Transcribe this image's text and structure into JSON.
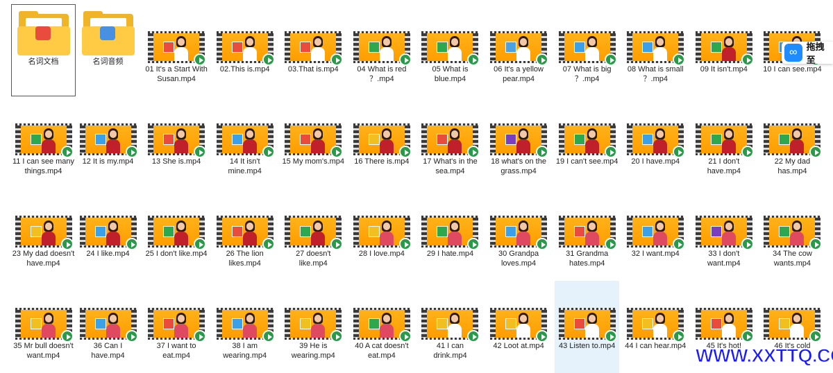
{
  "folders": [
    {
      "name": "名词文档",
      "badge_color": "#e74c3c",
      "selected": true
    },
    {
      "name": "名词音频",
      "badge_color": "#4a90e2",
      "selected": false
    }
  ],
  "videos": [
    {
      "name": "01 It's a Start With Susan.mp4",
      "card_color": "#e74c3c",
      "shirt_color": "#ffffff"
    },
    {
      "name": "02.This is.mp4",
      "card_color": "#e74c3c",
      "shirt_color": "#ffffff"
    },
    {
      "name": "03.That is.mp4",
      "card_color": "#e74c3c",
      "shirt_color": "#ffffff"
    },
    {
      "name": "04 What is red ？.mp4",
      "card_color": "#2ea84f",
      "shirt_color": "#ffffff"
    },
    {
      "name": "05 What is blue.mp4",
      "card_color": "#2ea84f",
      "shirt_color": "#ffffff"
    },
    {
      "name": "06 It's a yellow pear.mp4",
      "card_color": "#4aa3e0",
      "shirt_color": "#ffffff"
    },
    {
      "name": "07 What is big ？.mp4",
      "card_color": "#3aa0e8",
      "shirt_color": "#ffffff"
    },
    {
      "name": "08 What is small ？.mp4",
      "card_color": "#3aa0e8",
      "shirt_color": "#ffffff"
    },
    {
      "name": "09 It isn't.mp4",
      "card_color": "#2ea84f",
      "shirt_color": "#c0202a"
    },
    {
      "name": "10 I can see.mp4",
      "card_color": "#3aa0e8",
      "shirt_color": "#ffffff"
    },
    {
      "name": "11 I can see many things.mp4",
      "card_color": "#2ea84f",
      "shirt_color": "#c0202a"
    },
    {
      "name": "12 It is my.mp4",
      "card_color": "#3aa0e8",
      "shirt_color": "#c0202a"
    },
    {
      "name": "13 She is.mp4",
      "card_color": "#e74c3c",
      "shirt_color": "#c0202a"
    },
    {
      "name": "14 It isn't mine.mp4",
      "card_color": "#3aa0e8",
      "shirt_color": "#c0202a"
    },
    {
      "name": "15 My mom's.mp4",
      "card_color": "#e74c3c",
      "shirt_color": "#c0202a"
    },
    {
      "name": "16 There is.mp4",
      "card_color": "#f0c020",
      "shirt_color": "#c0202a"
    },
    {
      "name": "17 What's in the sea.mp4",
      "card_color": "#e74c3c",
      "shirt_color": "#c0202a"
    },
    {
      "name": "18 what's on the grass.mp4",
      "card_color": "#7a3fc0",
      "shirt_color": "#c0202a"
    },
    {
      "name": "19 I can't see.mp4",
      "card_color": "#2ea84f",
      "shirt_color": "#c0202a"
    },
    {
      "name": "20 I have.mp4",
      "card_color": "#3aa0e8",
      "shirt_color": "#c0202a"
    },
    {
      "name": "21 I don't have.mp4",
      "card_color": "#2ea84f",
      "shirt_color": "#c0202a"
    },
    {
      "name": "22 My dad has.mp4",
      "card_color": "#2ea84f",
      "shirt_color": "#c0202a"
    },
    {
      "name": "23 My dad doesn't have.mp4",
      "card_color": "#f0c020",
      "shirt_color": "#c0202a"
    },
    {
      "name": "24 I like.mp4",
      "card_color": "#3aa0e8",
      "shirt_color": "#c0202a"
    },
    {
      "name": "25 I don't like.mp4",
      "card_color": "#2ea84f",
      "shirt_color": "#c0202a"
    },
    {
      "name": "26 The lion likes.mp4",
      "card_color": "#e74c3c",
      "shirt_color": "#c0202a"
    },
    {
      "name": "27 doesn't like.mp4",
      "card_color": "#2ea84f",
      "shirt_color": "#c0202a"
    },
    {
      "name": "28 I love.mp4",
      "card_color": "#f0c020",
      "shirt_color": "#e04a60"
    },
    {
      "name": "29 I hate.mp4",
      "card_color": "#2ea84f",
      "shirt_color": "#e04a60"
    },
    {
      "name": "30 Grandpa loves.mp4",
      "card_color": "#3aa0e8",
      "shirt_color": "#e04a60"
    },
    {
      "name": "31 Grandma hates.mp4",
      "card_color": "#e74c3c",
      "shirt_color": "#e04a60"
    },
    {
      "name": "32 I want.mp4",
      "card_color": "#3aa0e8",
      "shirt_color": "#e04a60"
    },
    {
      "name": "33 I don't want.mp4",
      "card_color": "#7a3fc0",
      "shirt_color": "#e04a60"
    },
    {
      "name": "34 The cow wants.mp4",
      "card_color": "#2ea84f",
      "shirt_color": "#e04a60"
    },
    {
      "name": "35 Mr bull doesn't want.mp4",
      "card_color": "#f0c020",
      "shirt_color": "#e04a60"
    },
    {
      "name": "36 Can I have.mp4",
      "card_color": "#3aa0e8",
      "shirt_color": "#e04a60"
    },
    {
      "name": "37 I want to eat.mp4",
      "card_color": "#e74c3c",
      "shirt_color": "#e04a60"
    },
    {
      "name": "38 I am wearing.mp4",
      "card_color": "#3aa0e8",
      "shirt_color": "#e04a60"
    },
    {
      "name": "39 He is wearing.mp4",
      "card_color": "#f0c020",
      "shirt_color": "#e04a60"
    },
    {
      "name": "40 A cat doesn't eat.mp4",
      "card_color": "#2ea84f",
      "shirt_color": "#e04a60"
    },
    {
      "name": "41 I can drink.mp4",
      "card_color": "#f0c020",
      "shirt_color": "#ffffff"
    },
    {
      "name": "42 Loot at.mp4",
      "card_color": "#f0c020",
      "shirt_color": "#ffffff"
    },
    {
      "name": "43 Listen to.mp4",
      "card_color": "#e74c3c",
      "shirt_color": "#ffffff",
      "highlight": true
    },
    {
      "name": "44 I can hear.mp4",
      "card_color": "#f0c020",
      "shirt_color": "#ffffff"
    },
    {
      "name": "45 It's hot!",
      "card_color": "#e74c3c",
      "shirt_color": "#ffffff"
    },
    {
      "name": "46 It's cold",
      "card_color": "#f0c020",
      "shirt_color": "#ffffff"
    }
  ],
  "widget": {
    "label": "拖拽至",
    "icon": "cloud-drive-icon"
  },
  "watermark": "WWW.XXTTQ.COM"
}
